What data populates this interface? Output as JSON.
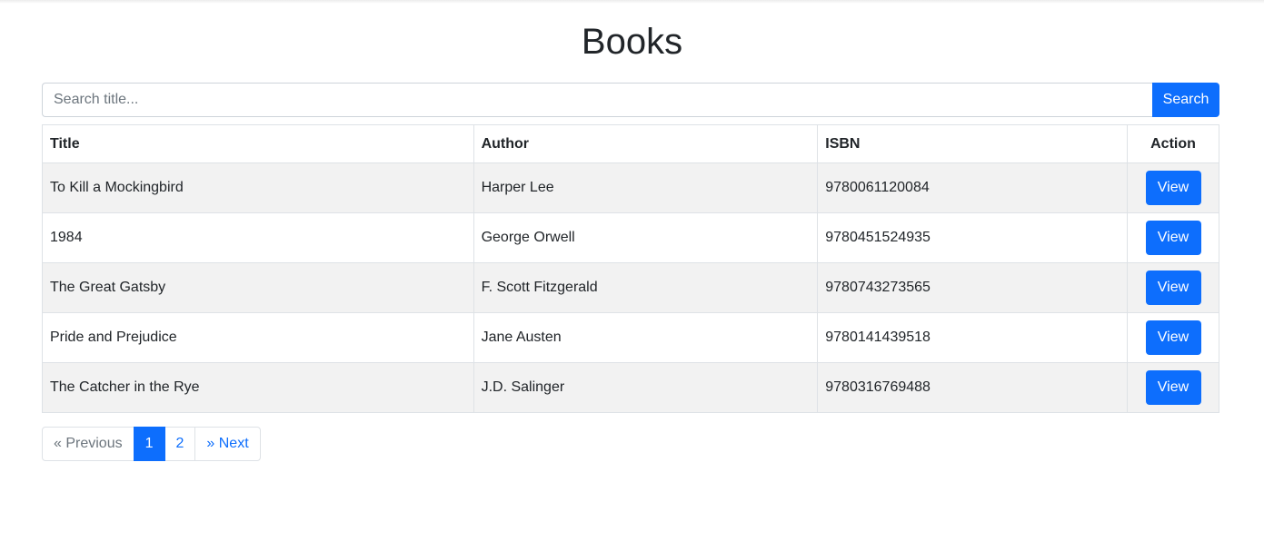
{
  "page": {
    "title": "Books"
  },
  "search": {
    "placeholder": "Search title...",
    "value": "",
    "button_label": "Search"
  },
  "table": {
    "headers": {
      "title": "Title",
      "author": "Author",
      "isbn": "ISBN",
      "action": "Action"
    },
    "rows": [
      {
        "title": "To Kill a Mockingbird",
        "author": "Harper Lee",
        "isbn": "9780061120084",
        "action_label": "View"
      },
      {
        "title": "1984",
        "author": "George Orwell",
        "isbn": "9780451524935",
        "action_label": "View"
      },
      {
        "title": "The Great Gatsby",
        "author": "F. Scott Fitzgerald",
        "isbn": "9780743273565",
        "action_label": "View"
      },
      {
        "title": "Pride and Prejudice",
        "author": "Jane Austen",
        "isbn": "9780141439518",
        "action_label": "View"
      },
      {
        "title": "The Catcher in the Rye",
        "author": "J.D. Salinger",
        "isbn": "9780316769488",
        "action_label": "View"
      }
    ]
  },
  "pagination": {
    "previous_label": "« Previous",
    "pages": [
      "1",
      "2"
    ],
    "active_page": "1",
    "next_label": "» Next"
  },
  "colors": {
    "primary": "#0d6efd",
    "stripe": "#f2f2f2",
    "border": "#dee2e6",
    "muted": "#6c757d"
  }
}
